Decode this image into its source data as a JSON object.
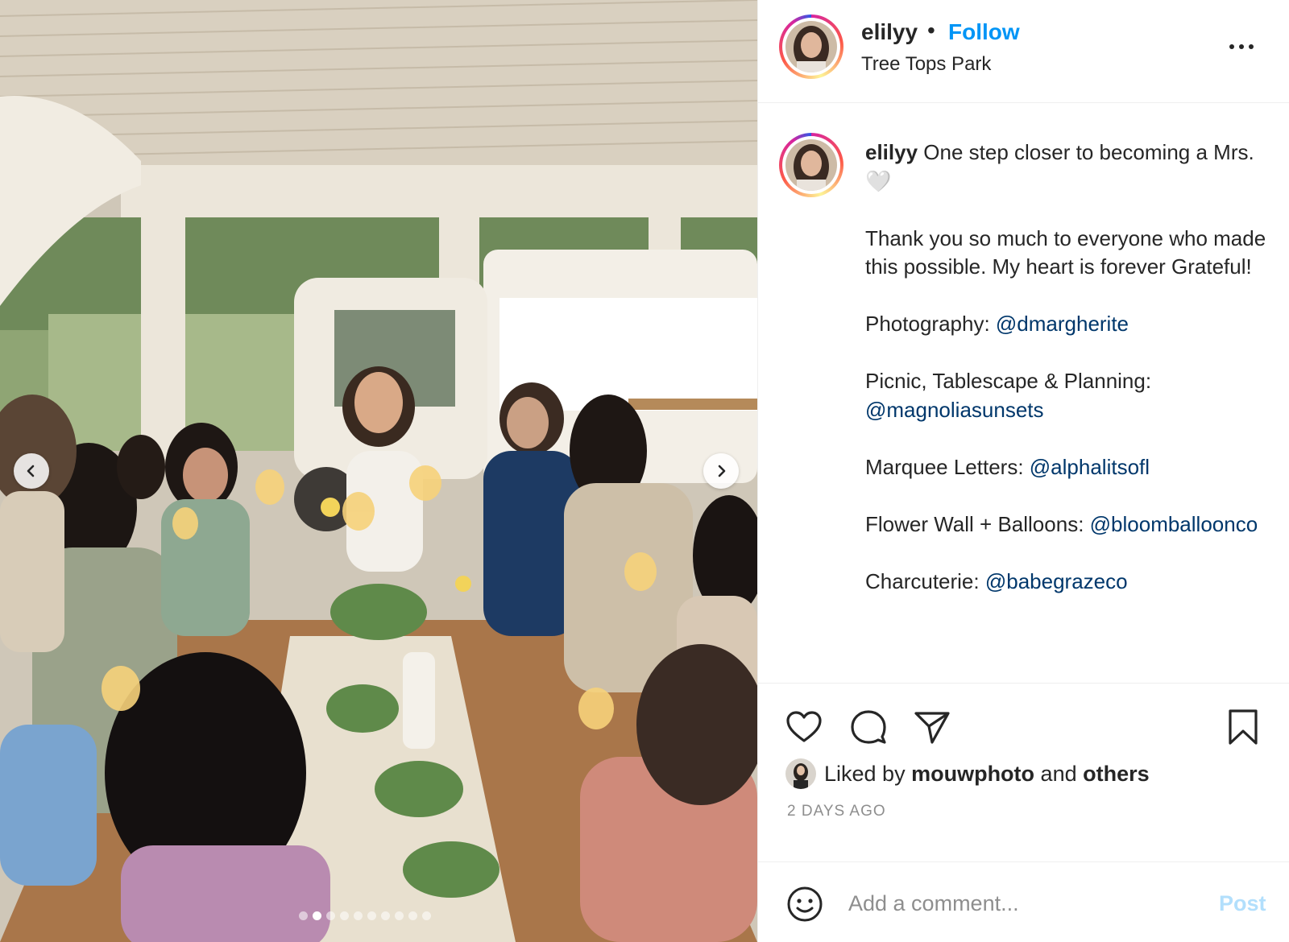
{
  "post": {
    "username": "elilyy",
    "separator": "•",
    "follow_label": "Follow",
    "location": "Tree Tops Park"
  },
  "caption": {
    "username": "elilyy",
    "line1": "One step closer to becoming a Mrs. 🤍",
    "line2": "Thank you so much to everyone who made this possible. My heart is forever Grateful!",
    "credits": [
      {
        "label": "Photography: ",
        "handle": "@dmargherite"
      },
      {
        "label": "Picnic, Tablescape & Planning: ",
        "handle": "@magnoliasunsets"
      },
      {
        "label": "Marquee Letters: ",
        "handle": "@alphalitsofl"
      },
      {
        "label": "Flower Wall + Balloons: ",
        "handle": "@bloomballoonco"
      },
      {
        "label": "Charcuterie: ",
        "handle": "@babegrazeco"
      }
    ]
  },
  "likes": {
    "prefix": "Liked by ",
    "user": "mouwphoto",
    "middle": " and ",
    "others": "others"
  },
  "timestamp": "2 DAYS AGO",
  "comment": {
    "placeholder": "Add a comment...",
    "post_label": "Post"
  },
  "carousel": {
    "total": 10,
    "active_index": 1
  },
  "icons": {
    "prev": "chevron-left-icon",
    "next": "chevron-right-icon",
    "more": "more-horizontal-icon",
    "like": "heart-icon",
    "comment": "comment-bubble-icon",
    "share": "paper-plane-icon",
    "save": "bookmark-icon",
    "emoji": "smiley-icon"
  },
  "colors": {
    "follow": "#0095f6",
    "mention": "#00376b",
    "post_disabled": "#b2dffc",
    "muted": "#8e8e8e"
  }
}
